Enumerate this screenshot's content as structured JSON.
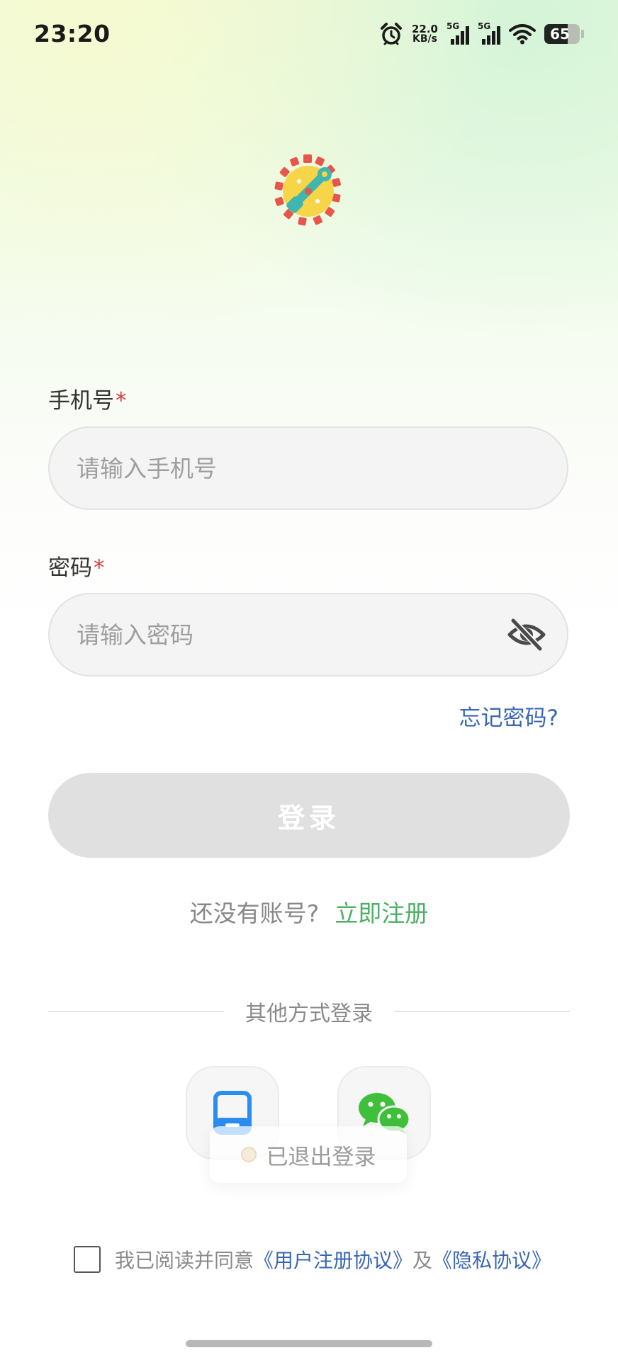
{
  "status_bar": {
    "time": "23:20",
    "net_speed_value": "22.0",
    "net_speed_unit": "KB/s",
    "signal_1_label": "5G",
    "signal_2_label": "5G",
    "battery_level": "65",
    "battery_fraction": 0.65,
    "icons": [
      "alarm-icon",
      "signal-icon",
      "signal-icon",
      "wifi-icon",
      "battery-icon"
    ]
  },
  "app_logo": "app-logo",
  "phone": {
    "label": "手机号",
    "required_mark": "*",
    "placeholder": "请输入手机号",
    "value": ""
  },
  "password": {
    "label": "密码",
    "required_mark": "*",
    "placeholder": "请输入密码",
    "value": "",
    "toggle_icon": "eye-off-icon"
  },
  "forgot_password": "忘记密码?",
  "login_button": "登录",
  "register": {
    "question": "还没有账号?",
    "link": "立即注册"
  },
  "other_login": {
    "divider_text": "其他方式登录",
    "methods": [
      {
        "name": "phone-login",
        "icon": "tablet-icon"
      },
      {
        "name": "wechat-login",
        "icon": "wechat-icon"
      }
    ]
  },
  "toast": {
    "message": "已退出登录"
  },
  "agreement": {
    "checked": false,
    "prefix": "我已阅读并同意",
    "user_agreement": "《用户注册协议》",
    "conjunction": "及",
    "privacy_agreement": "《隐私协议》"
  },
  "colors": {
    "link_blue": "#3a67b3",
    "register_green": "#4caf65",
    "required_red": "#d83a3a",
    "button_disabled": "#e0e0e0",
    "tablet_blue": "#2a8ef0",
    "wechat_green": "#3fbf3a"
  }
}
